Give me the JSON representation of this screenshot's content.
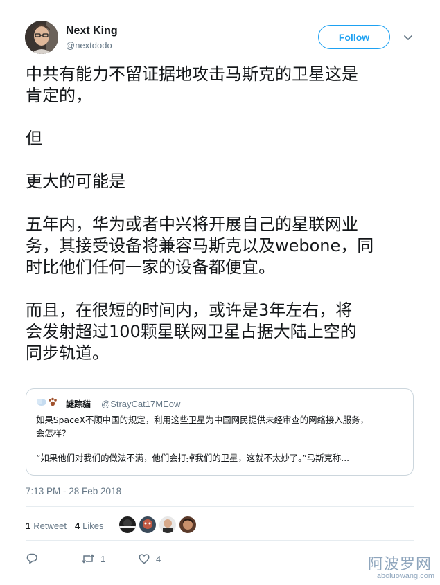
{
  "author": {
    "name": "Next King",
    "handle": "@nextdodo"
  },
  "follow_label": "Follow",
  "tweet_lines": [
    "中共有能力不留证据地攻击马斯克的卫星这是",
    "肯定的，",
    "",
    "但",
    "",
    "更大的可能是",
    "",
    "五年内，华为或者中兴将开展自己的星联网业",
    "务，其接受设备将兼容马斯克以及webone，同",
    "时比他们任何一家的设备都便宜。",
    "",
    "而且，在很短的时间内，或许是3年左右，将",
    "会发射超过100颗星联网卫星占据大陆上空的",
    "同步轨道。"
  ],
  "quoted": {
    "name": "謎踪貓",
    "handle": "@StrayCat17MEow",
    "lines": [
      "如果SpaceX不顾中国的规定，利用这些卫星为中国网民提供未经审查的网络接入服务，",
      "会怎样？",
      "",
      "“如果他们对我们的做法不满，他们会打掉我们的卫星，这就不太妙了。”马斯克称..."
    ]
  },
  "timestamp": "7:13 PM - 28 Feb 2018",
  "stats": {
    "retweet_count": "1",
    "retweet_label": "Retweet",
    "like_count": "4",
    "like_label": "Likes"
  },
  "actions": {
    "reply_icon": "reply-icon",
    "retweet_count": "1",
    "like_count": "4"
  },
  "watermark": {
    "cn": "阿波罗网",
    "url": "aboluowang.com"
  },
  "colors": {
    "accent": "#1da1f2",
    "secondary_text": "#657786",
    "border": "#e6ecf0"
  }
}
